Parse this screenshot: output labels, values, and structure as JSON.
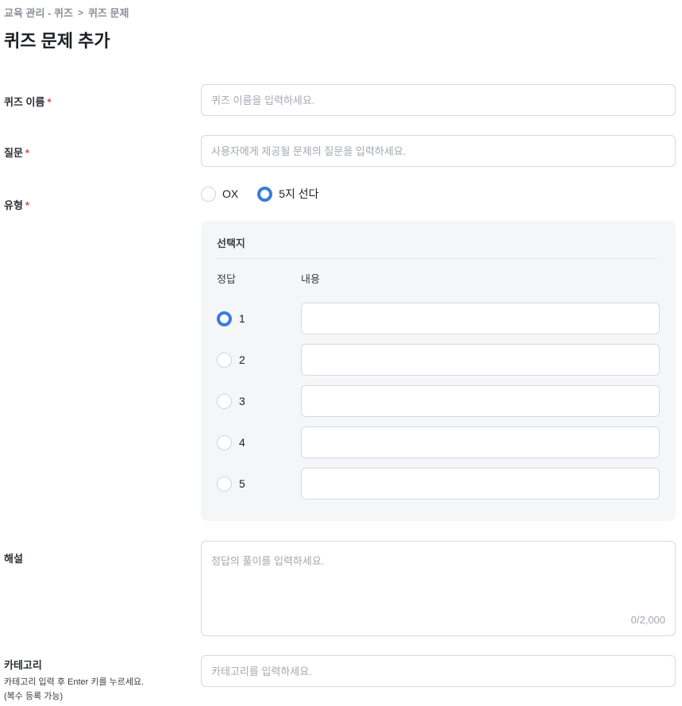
{
  "breadcrumb": {
    "part1": "교육 관리 - 퀴즈",
    "separator": ">",
    "part2": "퀴즈 문제"
  },
  "page_title": "퀴즈 문제 추가",
  "fields": {
    "quiz_name": {
      "label": "퀴즈 이름",
      "required_mark": "*",
      "placeholder": "퀴즈 이름을 입력하세요."
    },
    "question": {
      "label": "질문",
      "required_mark": "*",
      "placeholder": "사용자에게 제공될 문제의 질문을 입력하세요."
    },
    "type": {
      "label": "유형",
      "required_mark": "*",
      "options": [
        {
          "label": "OX",
          "selected": false
        },
        {
          "label": "5지 선다",
          "selected": true
        }
      ]
    },
    "choices": {
      "title": "선택지",
      "col_answer": "정답",
      "col_content": "내용",
      "rows": [
        {
          "num": "1",
          "is_answer": true,
          "value": ""
        },
        {
          "num": "2",
          "is_answer": false,
          "value": ""
        },
        {
          "num": "3",
          "is_answer": false,
          "value": ""
        },
        {
          "num": "4",
          "is_answer": false,
          "value": ""
        },
        {
          "num": "5",
          "is_answer": false,
          "value": ""
        }
      ]
    },
    "explanation": {
      "label": "해설",
      "placeholder": "정답의 풀이를 입력하세요.",
      "char_count": "0/2,000"
    },
    "category": {
      "label": "카테고리",
      "hint_line1": "카테고리 입력 후 Enter 키를 누르세요.",
      "hint_line2": "(복수 등록 가능)",
      "placeholder": "카테고리를 입력하세요."
    }
  },
  "colors": {
    "accent": "#3a7be0",
    "required": "#e5484d",
    "panel_bg": "#f5f6f8",
    "border": "#d6d9de"
  }
}
